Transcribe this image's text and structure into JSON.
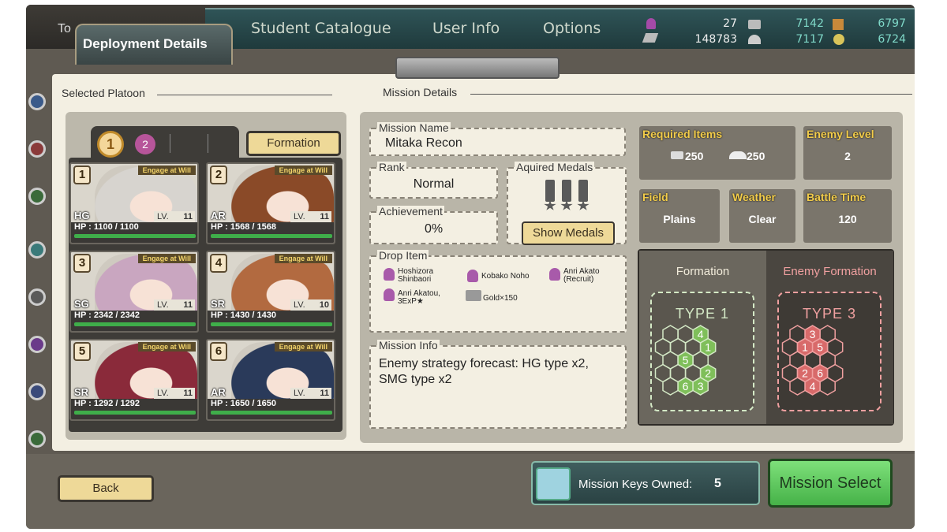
{
  "topbar": {
    "partial_tab": "To",
    "nav": [
      "Student Catalogue",
      "User Info",
      "Options"
    ],
    "resources": {
      "r1": "27",
      "r2": "148783",
      "r3": "7142",
      "r4": "7117",
      "r5": "6797",
      "r6": "6724"
    }
  },
  "header": {
    "title": "Deployment Details"
  },
  "platoon": {
    "label": "Selected Platoon",
    "tabs": [
      "1",
      "2"
    ],
    "formation_button": "Formation",
    "units": [
      {
        "num": "1",
        "engage": "Engage at Will",
        "type": "HG",
        "lv_label": "LV.",
        "lv": "11",
        "hp": "HP : 1100 / 1100",
        "hp_frac": 1.0,
        "hair": "#d7d4cf"
      },
      {
        "num": "2",
        "engage": "Engage at Will",
        "type": "AR",
        "lv_label": "LV.",
        "lv": "11",
        "hp": "HP : 1568 / 1568",
        "hp_frac": 1.0,
        "hair": "#8a4a28"
      },
      {
        "num": "3",
        "engage": "Engage at Will",
        "type": "SG",
        "lv_label": "LV.",
        "lv": "11",
        "hp": "HP : 2342 / 2342",
        "hp_frac": 1.0,
        "hair": "#c9a6c0"
      },
      {
        "num": "4",
        "engage": "Engage at Will",
        "type": "SR",
        "lv_label": "LV.",
        "lv": "10",
        "hp": "HP : 1430 / 1430",
        "hp_frac": 1.0,
        "hair": "#b26a40"
      },
      {
        "num": "5",
        "engage": "Engage at Will",
        "type": "SR",
        "lv_label": "LV.",
        "lv": "11",
        "hp": "HP : 1292 / 1292",
        "hp_frac": 1.0,
        "hair": "#8a2a3a"
      },
      {
        "num": "6",
        "engage": "Engage at Will",
        "type": "AR",
        "lv_label": "LV.",
        "lv": "11",
        "hp": "HP : 1650 / 1650",
        "hp_frac": 1.0,
        "hair": "#2a3a5a"
      }
    ]
  },
  "mission": {
    "label": "Mission Details",
    "name_label": "Mission Name",
    "name": "Mitaka Recon",
    "rank_label": "Rank",
    "rank": "Normal",
    "medals_label": "Aquired Medals",
    "show_medals": "Show Medals",
    "achievement_label": "Achievement",
    "achievement": "0%",
    "drop_label": "Drop Item",
    "drops": [
      "Hoshizora Shinbaori",
      "Kobako Noho",
      "Anri Akato (Recruit)",
      "Anri Akatou, 3ExP★",
      "Gold×150"
    ],
    "info_label": "Mission Info",
    "info": "Enemy strategy forecast: HG type x2, SMG type x2",
    "required_label": "Required Items",
    "req1": "250",
    "req2": "250",
    "enemy_level_label": "Enemy Level",
    "enemy_level": "2",
    "field_label": "Field",
    "field": "Plains",
    "weather_label": "Weather",
    "weather": "Clear",
    "battle_time_label": "Battle Time",
    "battle_time": "120",
    "formation_label": "Formation",
    "formation_type": "TYPE 1",
    "enemy_formation_label": "Enemy Formation",
    "enemy_formation_type": "TYPE 3",
    "player_hex_numbers": [
      "1",
      "2",
      "3",
      "4",
      "5",
      "6"
    ],
    "enemy_hex_numbers": [
      "1",
      "2",
      "3",
      "4",
      "5",
      "6"
    ]
  },
  "footer": {
    "back": "Back",
    "keys_label": "Mission Keys Owned:",
    "keys_value": "5",
    "mission_select": "Mission Select"
  },
  "colors": {
    "gold_button": "#eed998",
    "accent_yellow": "#f2cc4a",
    "hp_green": "#3fae4a",
    "player_hex": "#d4e9c6",
    "enemy_hex": "#f0a0a0"
  }
}
